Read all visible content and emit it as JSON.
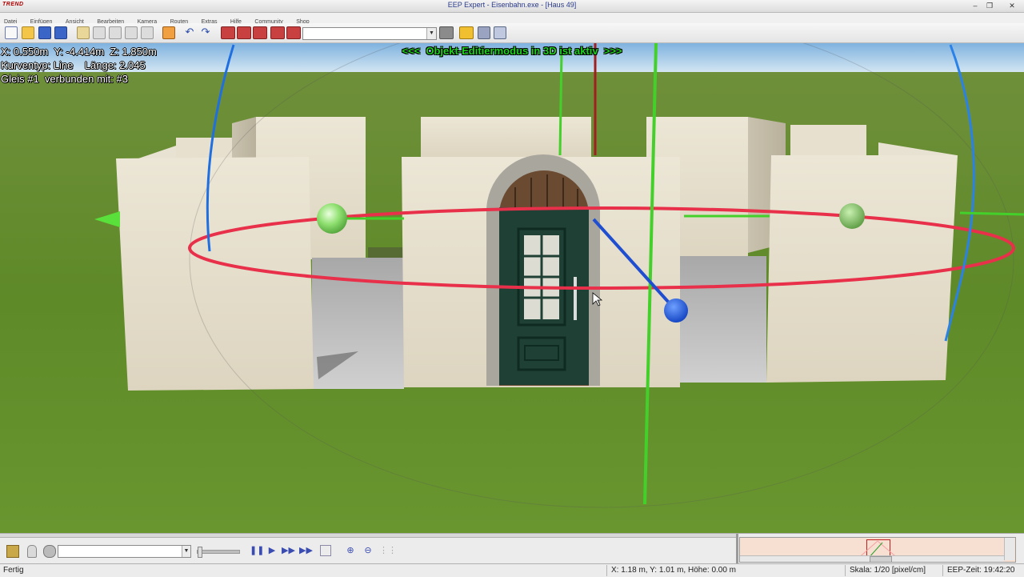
{
  "window": {
    "logo": "TREND",
    "title": "EEP Expert - Eisenbahn.exe - [Haus 49]"
  },
  "menu": [
    "Datei",
    "Einfügen",
    "Ansicht",
    "Bearbeiten",
    "Kamera",
    "Routen",
    "Extras",
    "Hilfe",
    "Community",
    "Shop"
  ],
  "toolbar": {
    "combo_value": ""
  },
  "viewport": {
    "coords": "X: 0.550m  Y: -4.414m  Z: 1.850m",
    "curve": "Kurventyp: Line    Länge: 2.045",
    "track": "Gleis #1  verbunden mit: #3",
    "mode_banner": "<<<  Objekt-Editiermodus in 3D ist aktiv  >>>"
  },
  "bottom": {
    "combo_value": ""
  },
  "statusbar": {
    "status": "Fertig",
    "position": "X: 1.18 m, Y: 1.01 m, Höhe: 0.00 m",
    "scale": "Skala: 1/20 [pixel/cm]",
    "time": "EEP-Zeit: 19:42:20"
  },
  "colors": {
    "x_axis": "#e8304a",
    "y_axis": "#44d02a",
    "z_axis": "#1f62d8",
    "banner": "#1fd21f",
    "door": "#1f4034"
  }
}
